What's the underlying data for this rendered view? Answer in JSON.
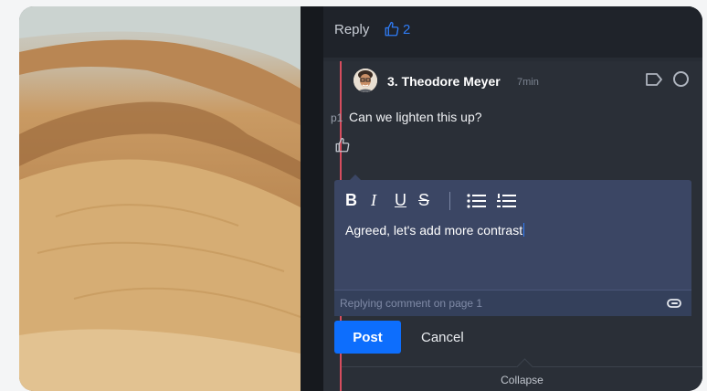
{
  "reply_bar": {
    "reply_label": "Reply",
    "like_count": "2"
  },
  "comment": {
    "author": "3. Theodore Meyer",
    "time": "7min",
    "page_ref": "p1",
    "text": "Can we lighten this up?"
  },
  "editor": {
    "toolbar": {
      "bold": "B",
      "italic": "I",
      "underline": "U",
      "strikethrough": "S"
    },
    "text": "Agreed, let's add more contrast",
    "footer": "Replying comment on page 1"
  },
  "actions": {
    "post_label": "Post",
    "cancel_label": "Cancel",
    "collapse_label": "Collapse"
  },
  "colors": {
    "accent": "#0d6efd",
    "thread_line": "#d64d5e",
    "editor_bg": "#3b4664"
  },
  "icons": [
    "thumbs-up-icon",
    "tag-icon",
    "resolve-circle-icon",
    "bulleted-list-icon",
    "numbered-list-icon",
    "paperclip-icon"
  ]
}
